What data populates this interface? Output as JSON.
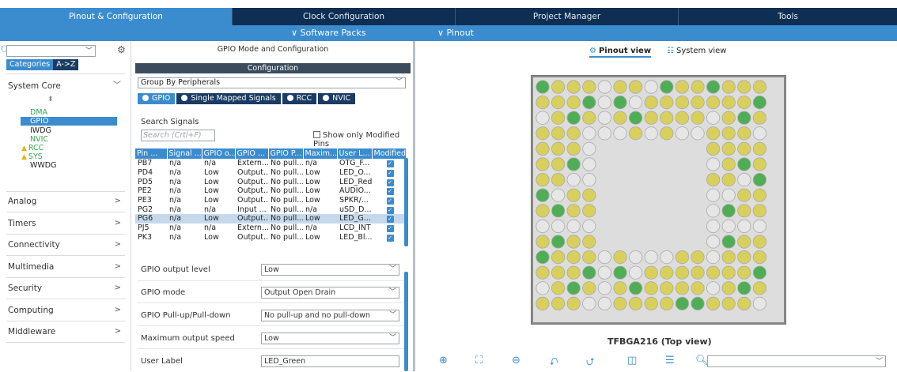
{
  "tabs": [
    {
      "label": "Pinout & Configuration",
      "active": true
    },
    {
      "label": "Clock Configuration",
      "active": false
    },
    {
      "label": "Project Manager",
      "active": false
    },
    {
      "label": "Tools",
      "active": false
    }
  ],
  "subbar": {
    "software_packs": "∨ Software Packs",
    "pinout": "∨ Pinout"
  },
  "left": {
    "search_value": "",
    "cat_tab_categories": "Categories",
    "cat_tab_az": "A->Z",
    "system_core": "System Core",
    "system_core_items": {
      "dma": "DMA",
      "gpio": "GPIO",
      "iwdg": "IWDG",
      "nvic": "NVIC",
      "rcc": "RCC",
      "sys": "SYS",
      "wwdg": "WWDG"
    },
    "sections": {
      "analog": "Analog",
      "timers": "Timers",
      "connectivity": "Connectivity",
      "multimedia": "Multimedia",
      "security": "Security",
      "computing": "Computing",
      "middleware": "Middleware"
    }
  },
  "mid": {
    "header": "GPIO Mode and Configuration",
    "config_bar": "Configuration",
    "group_by": "Group By Peripherals",
    "ptabs": [
      "GPIO",
      "Single Mapped Signals",
      "RCC",
      "NVIC"
    ],
    "search_label": "Search Signals",
    "search_placeholder": "Search (Crtl+F)",
    "modified_label": "Show only Modified Pins",
    "columns": [
      "Pin ...",
      "Signal ...",
      "GPIO o...",
      "GPIO ...",
      "GPIO P...",
      "Maxim...",
      "User L...",
      "Modified"
    ],
    "rows": [
      [
        "PB7",
        "n/a",
        "n/a",
        "Extern...",
        "No pull...",
        "n/a",
        "OTG_F..."
      ],
      [
        "PD4",
        "n/a",
        "Low",
        "Output...",
        "No pull...",
        "Low",
        "LED_O..."
      ],
      [
        "PD5",
        "n/a",
        "Low",
        "Output...",
        "No pull...",
        "Low",
        "LED_Red"
      ],
      [
        "PE2",
        "n/a",
        "Low",
        "Output...",
        "No pull...",
        "Low",
        "AUDIO..."
      ],
      [
        "PE3",
        "n/a",
        "Low",
        "Output...",
        "No pull...",
        "Low",
        "SPKR/..."
      ],
      [
        "PG2",
        "n/a",
        "n/a",
        "Input ...",
        "No pull...",
        "n/a",
        "uSD_D..."
      ],
      [
        "PG6",
        "n/a",
        "Low",
        "Output...",
        "No pull...",
        "Low",
        "LED_G..."
      ],
      [
        "PJ5",
        "n/a",
        "n/a",
        "Extern...",
        "No pull...",
        "n/a",
        "LCD_INT"
      ],
      [
        "PK3",
        "n/a",
        "Low",
        "Output...",
        "No pull...",
        "Low",
        "LED_Bl..."
      ]
    ],
    "selected_row": 6,
    "props": {
      "output_level_label": "GPIO output level",
      "output_level_value": "Low",
      "mode_label": "GPIO mode",
      "mode_value": "Output Open Drain",
      "pull_label": "GPIO Pull-up/Pull-down",
      "pull_value": "No pull-up and no pull-down",
      "speed_label": "Maximum output speed",
      "speed_value": "Low",
      "user_label_label": "User Label",
      "user_label_value": "LED_Green"
    }
  },
  "right": {
    "pinout_view": "Pinout view",
    "system_view": "System view",
    "chip_name": "TFBGA216 (Top view)",
    "pin_colors": {
      "yellow": "#d8cf5c",
      "green": "#4fae55",
      "gray": "#e6e6e6",
      "outline": "#aaaaaa"
    },
    "toolbar_icons": [
      "zoom-in-icon",
      "fit-icon",
      "zoom-out-icon",
      "rotate-right-icon",
      "rotate-left-icon",
      "flip-icon",
      "split-icon",
      "search-icon"
    ]
  },
  "colors": {
    "nav_dark": "#0e2e54",
    "accent": "#3b8ccf"
  }
}
